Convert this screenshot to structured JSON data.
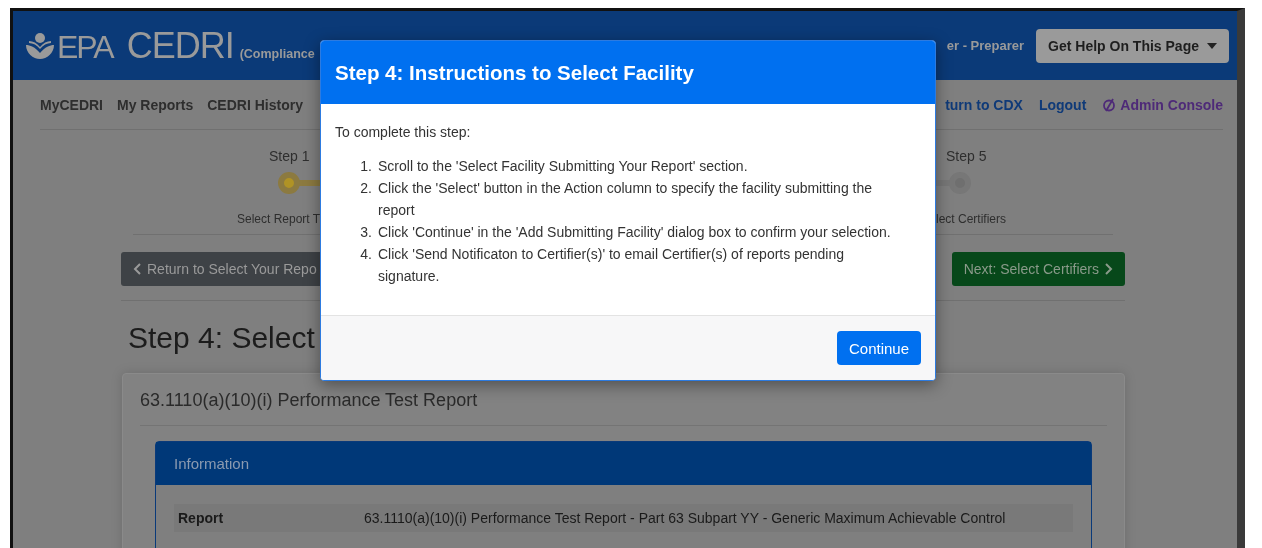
{
  "header": {
    "logo": "EPA",
    "app_name": "CEDRI",
    "subtitle": "(Compliance",
    "user_role": "er - Preparer",
    "help_button": "Get Help On This Page"
  },
  "nav": {
    "left": [
      "MyCEDRI",
      "My Reports",
      "CEDRI History"
    ],
    "right": [
      {
        "label": "turn to CDX",
        "kind": "link"
      },
      {
        "label": "Logout",
        "kind": "link"
      },
      {
        "label": "Admin Console",
        "kind": "admin"
      }
    ]
  },
  "steps": [
    {
      "label": "Step 1",
      "caption": "Select Report T",
      "current": true
    },
    {
      "label": "Step 5",
      "caption": "lect Certifiers",
      "current": false
    }
  ],
  "back_button": "Return to Select Your Repo",
  "next_button": "Next: Select Certifiers",
  "heading": "Step 4: Select",
  "card": {
    "title": "63.1110(a)(10)(i) Performance Test Report",
    "panel_title": "Information",
    "rows": [
      {
        "label": "Report",
        "value": "63.1110(a)(10)(i) Performance Test Report - Part 63 Subpart YY - Generic Maximum Achievable Control"
      }
    ]
  },
  "modal": {
    "title": "Step 4: Instructions to Select Facility",
    "intro": "To complete this step:",
    "steps": [
      {
        "number": "1.",
        "text": "Scroll to the 'Select Facility Submitting Your Report' section."
      },
      {
        "number": "2.",
        "text": "Click the 'Select' button in the Action column to specify the facility submitting the report"
      },
      {
        "number": "3.",
        "text": "Click 'Continue' in the 'Add Submitting Facility' dialog box to confirm your selection."
      },
      {
        "number": "4.",
        "text": "Click 'Send Notificaton to Certifier(s)' to email Certifier(s) of reports pending signature."
      }
    ],
    "button": "Continue"
  }
}
